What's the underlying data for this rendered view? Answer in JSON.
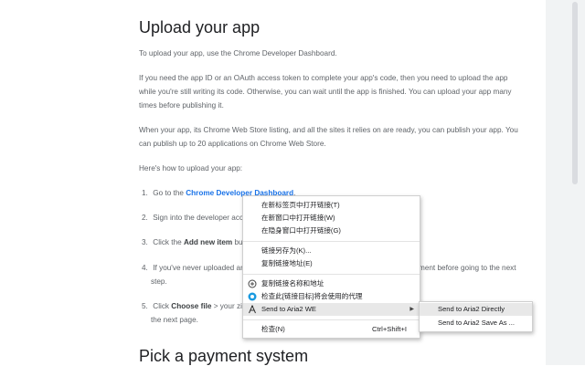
{
  "doc": {
    "heading_upload": "Upload your app",
    "para1": "To upload your app, use the Chrome Developer Dashboard.",
    "para2": "If you need the app ID or an OAuth access token to complete your app's code, then you need to upload the app while you're still writing its code. Otherwise, you can wait until the app is finished. You can upload your app many times before publishing it.",
    "para3": "When your app, its Chrome Web Store listing, and all the sites it relies on are ready, you can publish your app. You can publish up to 20 applications on Chrome Web Store.",
    "para4": "Here's how to upload your app:",
    "step1": {
      "num": "1.",
      "pre": "Go to the ",
      "link": "Chrome Developer Dashboard",
      "post": "."
    },
    "step2": {
      "num": "2.",
      "text": "Sign into the developer acco"
    },
    "step3": {
      "num": "3.",
      "pre": "Click the ",
      "bold": "Add new item",
      "post": " butt"
    },
    "step4": {
      "num": "4.",
      "line1": "If you've never uploaded an",
      "line1_tail": "ment before going to the next",
      "line2": "step."
    },
    "step5": {
      "num": "5.",
      "pre": "Click ",
      "bold": "Choose file",
      "post": " > your zip",
      "line2": "the next page."
    },
    "heading_payment": "Pick a payment system"
  },
  "context_menu": {
    "items": [
      {
        "label": "在新标签页中打开链接(T)"
      },
      {
        "label": "在新窗口中打开链接(W)"
      },
      {
        "label": "在隐身窗口中打开链接(G)"
      },
      {
        "label": "链接另存为(K)..."
      },
      {
        "label": "复制链接地址(E)"
      },
      {
        "label": "复制链接名称和地址",
        "icon": "copy-link-extension-icon"
      },
      {
        "label": "检查此[链接目标]将会使用的代理",
        "icon": "proxy-check-icon"
      },
      {
        "label": "Send to Aria2 WE",
        "icon": "aria2-icon",
        "has_submenu": true
      },
      {
        "label": "检查(N)",
        "shortcut": "Ctrl+Shift+I"
      }
    ]
  },
  "submenu": {
    "items": [
      {
        "label": "Send to Aria2 Directly"
      },
      {
        "label": "Send to Aria2 Save As ..."
      }
    ]
  },
  "colors": {
    "link": "#1a73e8",
    "heading": "#202124",
    "body_text": "#5f6368",
    "menu_highlight": "#e8e8e8"
  }
}
